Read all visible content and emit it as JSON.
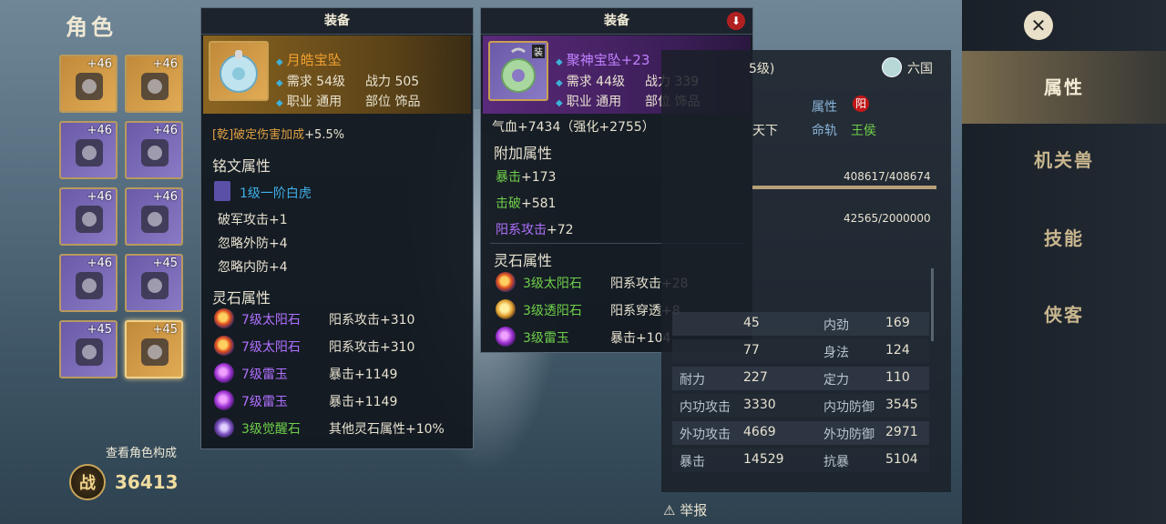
{
  "page": {
    "title": "角色",
    "view_composition": "查看角色构成",
    "power_icon": "战",
    "power_value": "36413"
  },
  "equipment_slots": [
    {
      "level": "+46",
      "icon": "gun-icon",
      "style": "gold"
    },
    {
      "level": "+46",
      "icon": "bow-icon",
      "style": "gold"
    },
    {
      "level": "+46",
      "icon": "belt-icon",
      "style": "purple"
    },
    {
      "level": "+46",
      "icon": "armor-icon",
      "style": "purple"
    },
    {
      "level": "+46",
      "icon": "bracer-icon",
      "style": "purple"
    },
    {
      "level": "+46",
      "icon": "boots-icon",
      "style": "purple"
    },
    {
      "level": "+46",
      "icon": "gauntlet-icon",
      "style": "purple"
    },
    {
      "level": "+45",
      "icon": "necklace-icon",
      "style": "purple"
    },
    {
      "level": "+45",
      "icon": "ring-icon",
      "style": "purple"
    },
    {
      "level": "+45",
      "icon": "pendant-icon",
      "style": "gold"
    }
  ],
  "tooltip_left": {
    "header": "装备",
    "name": "月皓宝坠",
    "req_label": "需求",
    "req_value": "54级",
    "power_label": "战力",
    "power_value": "505",
    "class_label": "职业",
    "class_value": "通用",
    "slot_label": "部位",
    "slot_value": "饰品",
    "special_prefix": "[乾]破定伤害加成",
    "special_value": "+5.5%",
    "inscription_title": "铭文属性",
    "inscription_name": "1级一阶白虎",
    "inscription_stats": [
      "破军攻击+1",
      "忽略外防+4",
      "忽略内防+4"
    ],
    "gem_title": "灵石属性",
    "gems": [
      {
        "name": "7级太阳石",
        "effect": "阳系攻击+310",
        "kind": "sun",
        "color": "#b070ff"
      },
      {
        "name": "7级太阳石",
        "effect": "阳系攻击+310",
        "kind": "sun",
        "color": "#b070ff"
      },
      {
        "name": "7级雷玉",
        "effect": "暴击+1149",
        "kind": "thunder",
        "color": "#b070ff"
      },
      {
        "name": "7级雷玉",
        "effect": "暴击+1149",
        "kind": "thunder",
        "color": "#b070ff"
      },
      {
        "name": "3级觉醒石",
        "effect": "其他灵石属性+10%",
        "kind": "wake",
        "color": "#6fcf4a"
      }
    ]
  },
  "tooltip_right": {
    "header": "装备",
    "equipped_badge": "装",
    "name": "聚神宝坠+23",
    "req_label": "需求",
    "req_value": "44级",
    "power_label": "战力",
    "power_value": "339",
    "class_label": "职业",
    "class_value": "通用",
    "slot_label": "部位",
    "slot_value": "饰品",
    "base_stat": "气血+7434（强化+2755）",
    "extra_title": "附加属性",
    "extra_stats": [
      {
        "text": "暴击+173",
        "label": "暴击",
        "value": "+173",
        "color": "#6fcf4a"
      },
      {
        "text": "击破+581",
        "label": "击破",
        "value": "+581",
        "color": "#6fcf4a"
      },
      {
        "text": "阳系攻击+72",
        "label": "阳系攻击",
        "value": "+72",
        "color": "#b070ff"
      }
    ],
    "gem_title": "灵石属性",
    "gems": [
      {
        "name": "3级太阳石",
        "effect": "阳系攻击+28",
        "kind": "sun"
      },
      {
        "name": "3级透阳石",
        "effect": "阳系穿透+8",
        "kind": "pierce"
      },
      {
        "name": "3级雷玉",
        "effect": "暴击+104",
        "kind": "thunder"
      }
    ]
  },
  "stats_panel": {
    "level_fragment": "5级)",
    "faction": "六国",
    "attr_label": "属性",
    "attr_value": "阳",
    "orbit_fragment": "天下",
    "orbit_label": "命轨",
    "orbit_value": "王侯",
    "hp": "408617/408674",
    "exp": "42565/2000000",
    "rows": [
      {
        "l1": "",
        "v1": "45",
        "l2": "内劲",
        "v2": "169"
      },
      {
        "l1": "",
        "v1": "77",
        "l2": "身法",
        "v2": "124"
      },
      {
        "l1": "耐力",
        "v1": "227",
        "l2": "定力",
        "v2": "110"
      },
      {
        "l1": "内功攻击",
        "v1": "3330",
        "l2": "内功防御",
        "v2": "3545"
      },
      {
        "l1": "外功攻击",
        "v1": "4669",
        "l2": "外功防御",
        "v2": "2971"
      },
      {
        "l1": "暴击",
        "v1": "14529",
        "l2": "抗暴",
        "v2": "5104"
      }
    ],
    "report": "举报"
  },
  "nav": {
    "items": [
      "属性",
      "机关兽",
      "技能",
      "侠客"
    ],
    "active": "属性",
    "close": "✕"
  }
}
